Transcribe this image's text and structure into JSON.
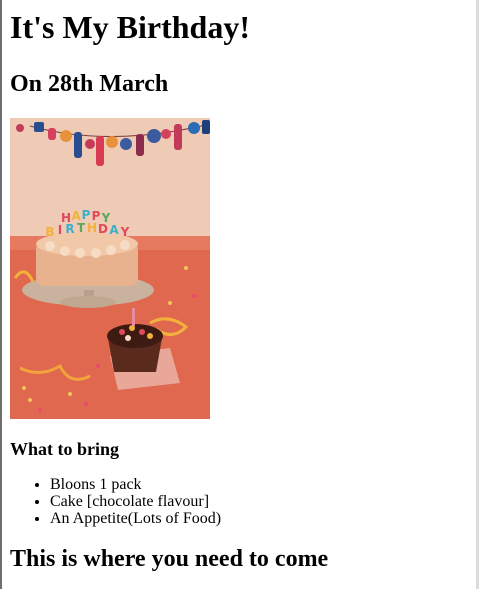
{
  "page": {
    "title": "It's My Birthday!",
    "date_heading": "On 28th March",
    "bring_heading": "What to bring",
    "bring_items": [
      "Bloons 1 pack",
      "Cake [chocolate flavour]",
      "An Appetite(Lots of Food)"
    ],
    "location_heading": "This is where you need to come"
  },
  "photo": {
    "banner_text": "HAPPY BIRTHDAY"
  },
  "colors": {
    "photo_background": "#e26d52",
    "wall": "#f0cbb6",
    "cake_frosting": "#e9b28f",
    "cupcake": "#5a2b1d"
  }
}
